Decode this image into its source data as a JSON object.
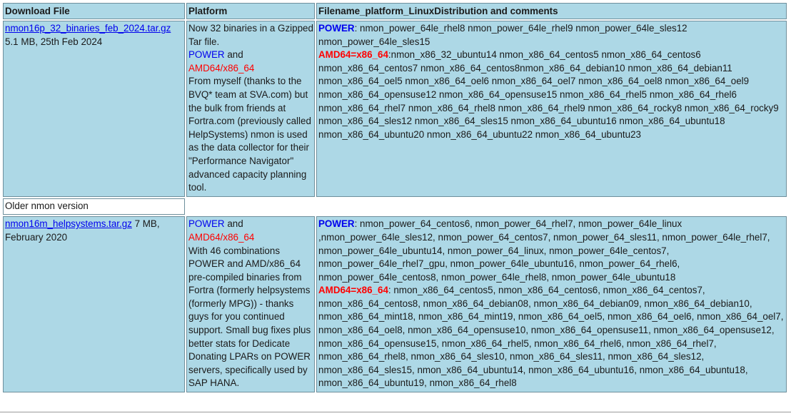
{
  "header": {
    "col1": "Download File",
    "col2": "Platform",
    "col3": "Filename_platform_LinuxDistribution and comments"
  },
  "row1": {
    "file_link": "nmon16p_32_binaries_feb_2024.tar.gz",
    "file_meta": "5.1 MB, 25th Feb 2024",
    "platform_intro": "Now 32 binaries in a Gzipped Tar file.",
    "platform_power": "POWER",
    "platform_and": " and",
    "platform_amd": "AMD64/x86_64",
    "platform_desc": "From myself (thanks to the BVQ* team at SVA.com) but the bulk from friends at Fortra.com (previously called HelpSystems) nmon is used as the data collector for their \"Performance Navigator\" advanced capacity planning tool.",
    "power_label": "POWER",
    "power_files": ": nmon_power_64le_rhel8 nmon_power_64le_rhel9 nmon_power_64le_sles12 nmon_power_64le_sles15",
    "amd_label": "AMD64=x86_64",
    "amd_files": ":nmon_x86_32_ubuntu14 nmon_x86_64_centos5 nmon_x86_64_centos6 nmon_x86_64_centos7 nmon_x86_64_centos8nmon_x86_64_debian10 nmon_x86_64_debian11 nmon_x86_64_oel5 nmon_x86_64_oel6 nmon_x86_64_oel7 nmon_x86_64_oel8 nmon_x86_64_oel9 nmon_x86_64_opensuse12 nmon_x86_64_opensuse15 nmon_x86_64_rhel5 nmon_x86_64_rhel6 nmon_x86_64_rhel7 nmon_x86_64_rhel8 nmon_x86_64_rhel9 nmon_x86_64_rocky8 nmon_x86_64_rocky9 nmon_x86_64_sles12 nmon_x86_64_sles15 nmon_x86_64_ubuntu16 nmon_x86_64_ubuntu18 nmon_x86_64_ubuntu20 nmon_x86_64_ubuntu22 nmon_x86_64_ubuntu23"
  },
  "older_label": "Older nmon version",
  "row2": {
    "file_link": "nmon16m_helpsystems.tar.gz",
    "file_meta": " 7 MB, February 2020",
    "platform_power": "POWER",
    "platform_and": " and",
    "platform_amd": "AMD64/x86_64",
    "platform_desc": "With 46 combinations POWER and AMD/x86_64 pre-compiled binaries from Fortra (formerly helpsystems (formerly MPG)) - thanks guys for you continued support. Small bug fixes plus better stats for Dedicate Donating LPARs on POWER servers, specifically used by SAP HANA.",
    "power_label": "POWER",
    "power_files": ": nmon_power_64_centos6, nmon_power_64_rhel7, nmon_power_64le_linux ,nmon_power_64le_sles12, nmon_power_64_centos7, nmon_power_64_sles11, nmon_power_64le_rhel7, nmon_power_64le_ubuntu14, nmon_power_64_linux, nmon_power_64le_centos7, nmon_power_64le_rhel7_gpu, nmon_power_64le_ubuntu16, nmon_power_64_rhel6, nmon_power_64le_centos8, nmon_power_64le_rhel8, nmon_power_64le_ubuntu18",
    "amd_label": "AMD64=x86_64",
    "amd_files": ": nmon_x86_64_centos5, nmon_x86_64_centos6, nmon_x86_64_centos7, nmon_x86_64_centos8, nmon_x86_64_debian08, nmon_x86_64_debian09, nmon_x86_64_debian10, nmon_x86_64_mint18, nmon_x86_64_mint19, nmon_x86_64_oel5, nmon_x86_64_oel6, nmon_x86_64_oel7, nmon_x86_64_oel8, nmon_x86_64_opensuse10, nmon_x86_64_opensuse11, nmon_x86_64_opensuse12, nmon_x86_64_opensuse15, nmon_x86_64_rhel5, nmon_x86_64_rhel6, nmon_x86_64_rhel7, nmon_x86_64_rhel8, nmon_x86_64_sles10, nmon_x86_64_sles11, nmon_x86_64_sles12, nmon_x86_64_sles15, nmon_x86_64_ubuntu14, nmon_x86_64_ubuntu16, nmon_x86_64_ubuntu18, nmon_x86_64_ubuntu19, nmon_x86_64_rhel8"
  },
  "colors": {
    "cell_bg": "#add8e6",
    "link": "#0000ee",
    "power": "#0000ee",
    "amd": "#ff0000"
  }
}
